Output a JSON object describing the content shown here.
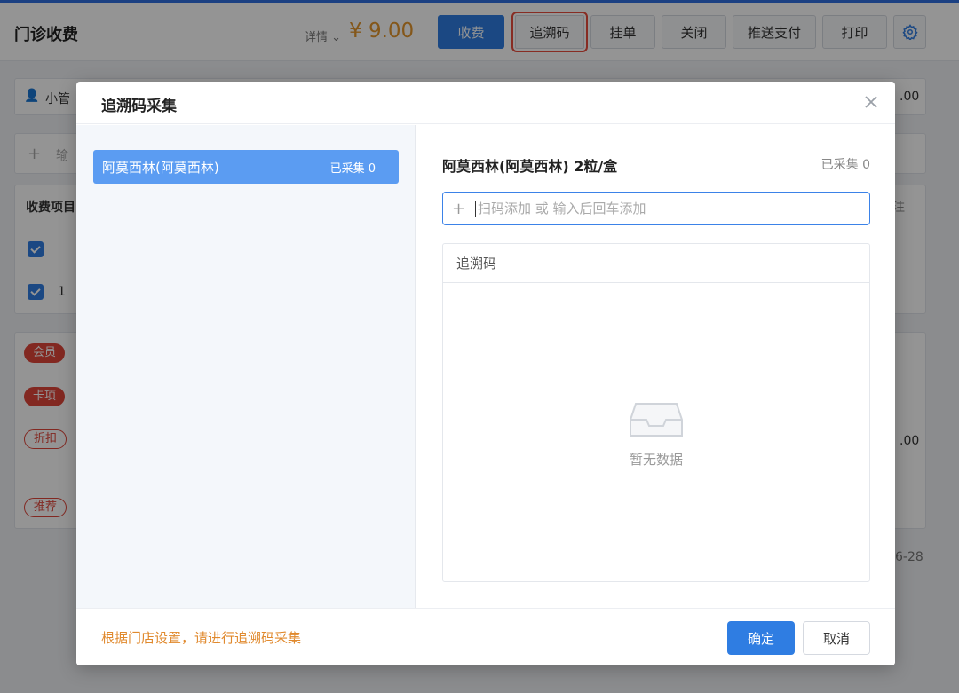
{
  "header": {
    "title": "门诊收费",
    "detail_label": "详情",
    "amount": "¥ 9.00",
    "buttons": {
      "charge": "收费",
      "trace_code": "追溯码",
      "hang": "挂单",
      "close": "关闭",
      "push_pay": "推送支付",
      "print": "打印"
    }
  },
  "background": {
    "user_name": "小管",
    "amount_right": ".00",
    "input_hint": "输",
    "col_header": "收费项目",
    "col_right": "注",
    "row2_qty": "1",
    "tags": {
      "member": "会员",
      "card": "卡项",
      "discount": "折扣",
      "recommend": "推荐"
    },
    "amount_right2": ".00",
    "date_fragment": "6-28"
  },
  "modal": {
    "title": "追溯码采集",
    "left_item": {
      "name": "阿莫西林(阿莫西林)",
      "count": "已采集 0"
    },
    "drug_title": "阿莫西林(阿莫西林) 2粒/盒",
    "collected": "已采集 0",
    "scan_placeholder": "扫码添加 或 输入后回车添加",
    "table_header": "追溯码",
    "empty_text": "暂无数据",
    "footer_tip": "根据门店设置，请进行追溯码采集",
    "ok_label": "确定",
    "cancel_label": "取消"
  },
  "colors": {
    "primary": "#2f7de2",
    "left_item_bg": "#5b9cf2",
    "amount": "#e4962e",
    "tip": "#e0892d",
    "highlight": "#e84c3d"
  }
}
